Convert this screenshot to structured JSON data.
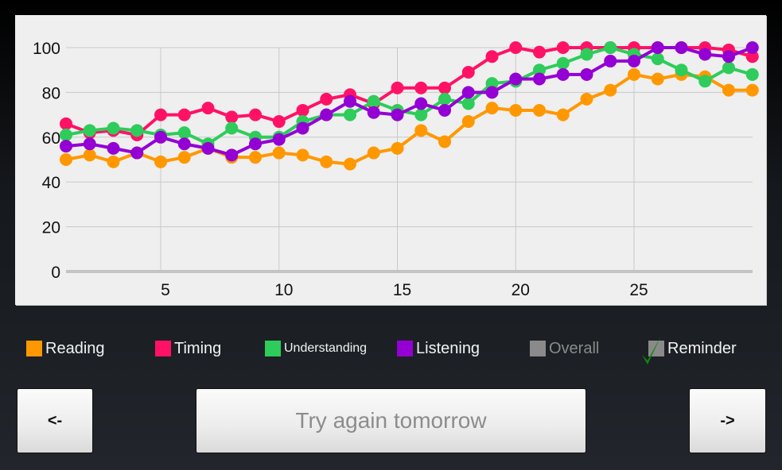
{
  "chart_data": {
    "type": "line",
    "title": "",
    "xlabel": "",
    "ylabel": "",
    "x": [
      1,
      2,
      3,
      4,
      5,
      6,
      7,
      8,
      9,
      10,
      11,
      12,
      13,
      14,
      15,
      16,
      17,
      18,
      19,
      20,
      21,
      22,
      23,
      24,
      25,
      26,
      27,
      28,
      29,
      30
    ],
    "xlim": [
      1,
      30
    ],
    "ylim": [
      0,
      100
    ],
    "x_ticks": [
      5,
      10,
      15,
      20,
      25
    ],
    "y_ticks": [
      0,
      20,
      40,
      60,
      80,
      100
    ],
    "x_tick_labels": [
      "5",
      "10",
      "15",
      "20",
      "25"
    ],
    "y_tick_labels": [
      "0",
      "20",
      "40",
      "60",
      "80",
      "100"
    ],
    "grid": true,
    "legend_position": "bottom",
    "series": [
      {
        "name": "Reading",
        "color": "#ff9800",
        "values": [
          50,
          52,
          49,
          53,
          49,
          51,
          55,
          51,
          51,
          53,
          52,
          49,
          48,
          53,
          55,
          63,
          58,
          67,
          73,
          72,
          72,
          70,
          77,
          81,
          88,
          86,
          88,
          87,
          81,
          81
        ]
      },
      {
        "name": "Timing",
        "color": "#ff1266",
        "values": [
          66,
          62,
          63,
          61,
          70,
          70,
          73,
          69,
          70,
          67,
          72,
          77,
          79,
          75,
          82,
          82,
          82,
          89,
          96,
          100,
          98,
          100,
          100,
          100,
          100,
          100,
          100,
          100,
          99,
          96
        ]
      },
      {
        "name": "Understanding",
        "color": "#2ecc5a",
        "values": [
          61,
          63,
          64,
          63,
          61,
          62,
          57,
          64,
          60,
          60,
          67,
          70,
          70,
          76,
          72,
          70,
          77,
          75,
          84,
          85,
          90,
          93,
          97,
          100,
          97,
          95,
          90,
          85,
          91,
          88
        ]
      },
      {
        "name": "Listening",
        "color": "#9400d3",
        "values": [
          56,
          57,
          55,
          53,
          60,
          57,
          55,
          52,
          57,
          59,
          64,
          70,
          76,
          71,
          70,
          75,
          72,
          80,
          80,
          86,
          86,
          88,
          88,
          94,
          94,
          100,
          100,
          97,
          96,
          100
        ]
      }
    ]
  },
  "legend": [
    {
      "label": "Reading",
      "color": "#ff9800",
      "enabled": true
    },
    {
      "label": "Timing",
      "color": "#ff1266",
      "enabled": true
    },
    {
      "label": "Understanding",
      "color": "#2ecc5a",
      "enabled": true
    },
    {
      "label": "Listening",
      "color": "#9400d3",
      "enabled": true
    },
    {
      "label": "Overall",
      "color": "#8a8a8a",
      "enabled": false
    },
    {
      "label": "Reminder",
      "color": "#8a8a8a",
      "checked": true,
      "check_color": "#0a8a0a"
    }
  ],
  "buttons": {
    "prev_label": "<-",
    "main_label": "Try again tomorrow",
    "next_label": "->"
  }
}
